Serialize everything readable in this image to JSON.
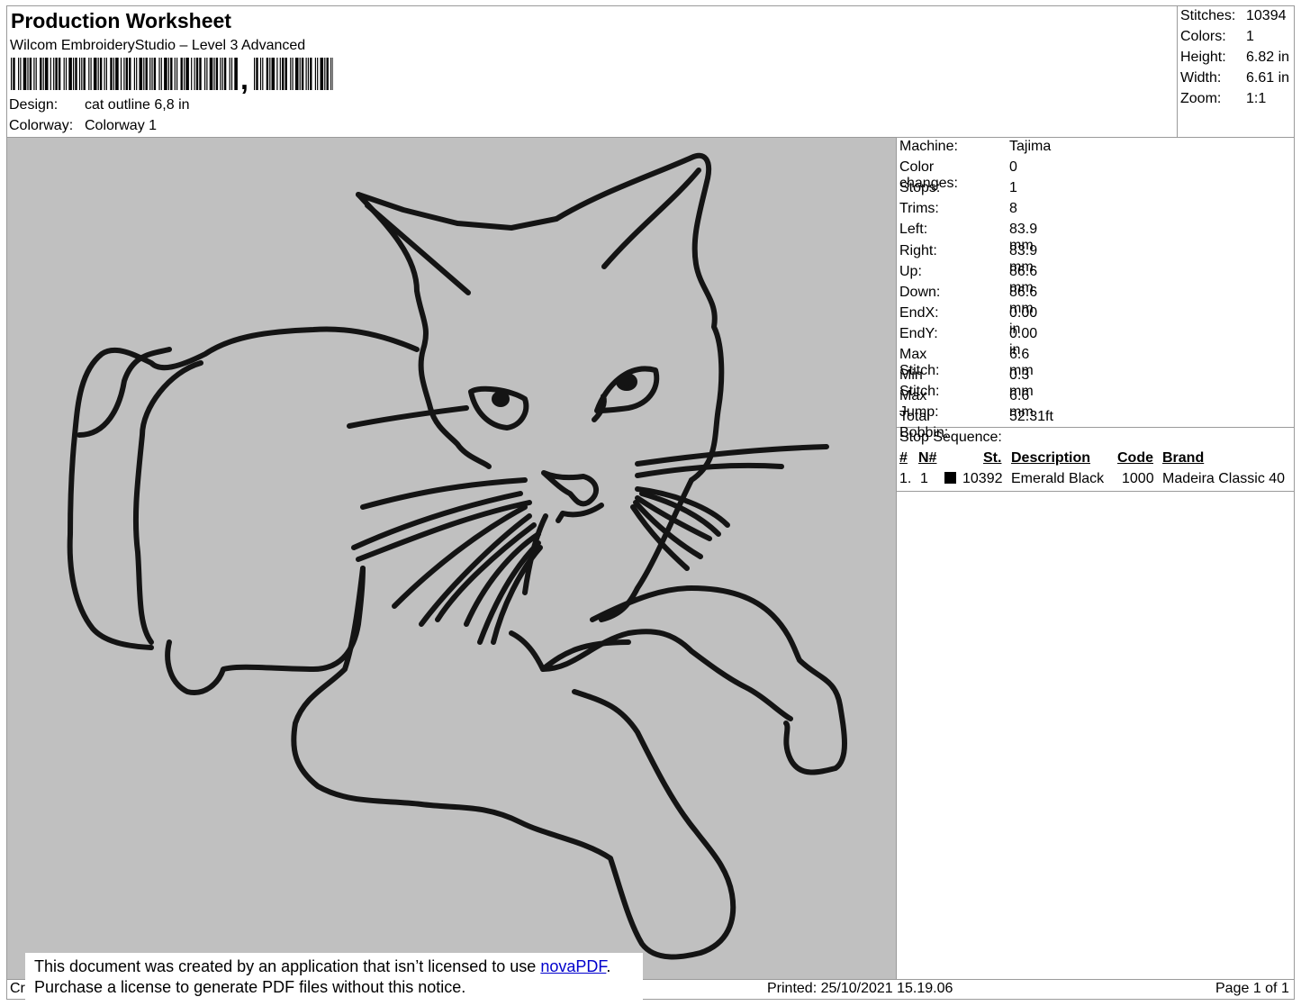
{
  "header": {
    "title": "Production Worksheet",
    "software": "Wilcom EmbroideryStudio – Level 3 Advanced",
    "barcode_sep": ",",
    "design_label": "Design:",
    "design_value": "cat outline 6,8 in",
    "colorway_label": "Colorway:",
    "colorway_value": "Colorway 1"
  },
  "summary": {
    "stitches_label": "Stitches:",
    "stitches_value": "10394",
    "colors_label": "Colors:",
    "colors_value": "1",
    "height_label": "Height:",
    "height_value": "6.82 in",
    "width_label": "Width:",
    "width_value": "6.61 in",
    "zoom_label": "Zoom:",
    "zoom_value": "1:1"
  },
  "machine_info": [
    {
      "label": "Machine:",
      "value": "Tajima"
    },
    {
      "label": "Color changes:",
      "value": "0"
    },
    {
      "label": "Stops:",
      "value": "1"
    },
    {
      "label": "Trims:",
      "value": "8"
    },
    {
      "label": "Left:",
      "value": "83.9 mm"
    },
    {
      "label": "Right:",
      "value": "83.9 mm"
    },
    {
      "label": "Up:",
      "value": "86.6 mm"
    },
    {
      "label": "Down:",
      "value": "86.6 mm"
    },
    {
      "label": "EndX:",
      "value": "0.00 in"
    },
    {
      "label": "EndY:",
      "value": "0.00 in"
    },
    {
      "label": "Max Stitch:",
      "value": "6.6 mm"
    },
    {
      "label": "Min Stitch:",
      "value": "0.3 mm"
    },
    {
      "label": "Max Jump:",
      "value": "6.6 mm"
    },
    {
      "label": "Total Bobbin:",
      "value": "52.31ft"
    }
  ],
  "stop_sequence": {
    "label": "Stop Sequence:",
    "headers": {
      "num": "#",
      "n": "N#",
      "st": "St.",
      "description": "Description",
      "code": "Code",
      "brand": "Brand"
    },
    "rows": [
      {
        "num": "1.",
        "n": "1",
        "st": "10392",
        "description": "Emerald Black",
        "code": "1000",
        "brand": "Madeira Classic 40",
        "color": "#000000"
      }
    ]
  },
  "design_canvas": {
    "background": "#c0c0c0",
    "thread_color": "#141414"
  },
  "footer": {
    "left_fragment": "Cr",
    "printed": "Printed: 25/10/2021 15.19.06",
    "page": "Page 1 of 1"
  },
  "notice": {
    "line1_prefix": "This document was created by an application that isn’t licensed to use ",
    "link": "novaPDF",
    "line1_suffix": ".",
    "line2": "Purchase a license to generate PDF files without this notice."
  }
}
